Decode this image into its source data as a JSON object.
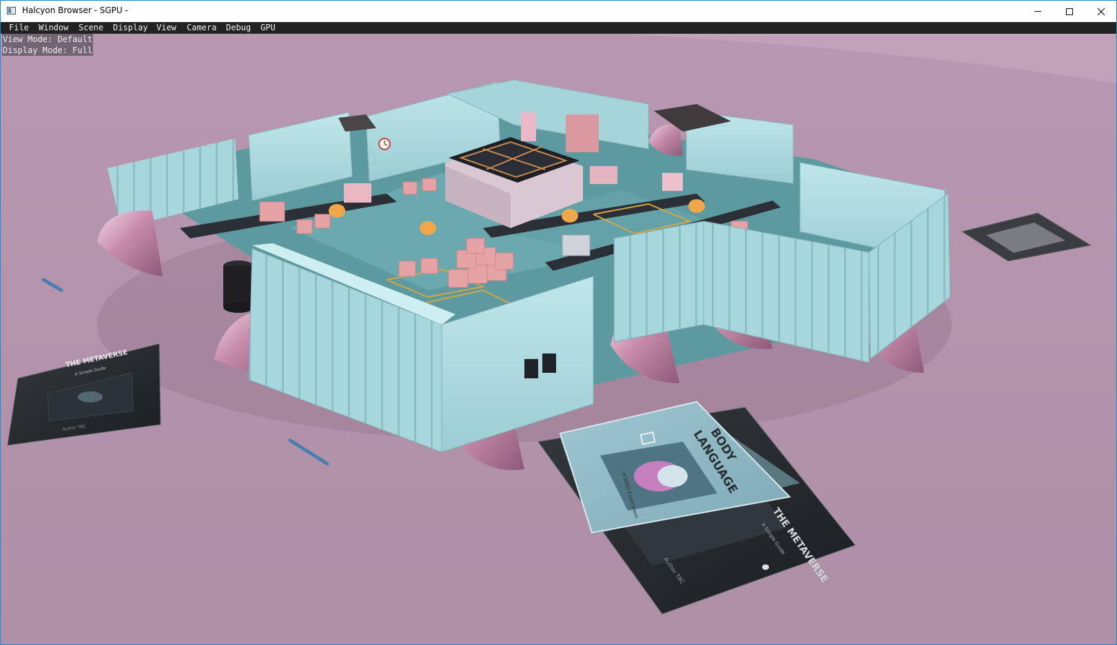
{
  "window": {
    "title": "Halcyon Browser - SGPU -",
    "icon": "app-window-icon",
    "controls": [
      "minimize-icon",
      "maximize-icon",
      "close-icon"
    ]
  },
  "menubar": {
    "items": [
      "File",
      "Window",
      "Scene",
      "Display",
      "View",
      "Camera",
      "Debug",
      "GPU"
    ]
  },
  "overlay": {
    "view_mode": "View Mode: Default",
    "display_mode": "Display Mode: Full"
  },
  "scene": {
    "book_left": {
      "title": "THE METAVERSE",
      "subtitle": "A Simple Guide",
      "author": "Author  TBC"
    },
    "book_front": {
      "title_line1": "BODY",
      "title_line2": "LANGUAGE",
      "subtitle": "A SEED Experiment"
    },
    "book_back": {
      "title": "THE METAVERSE",
      "subtitle": "A Simple Guide",
      "author": "Author  TBC"
    }
  },
  "colors": {
    "ground": "#b293ab",
    "wall": "#a9d9e0",
    "floor": "#5f9fa4",
    "box": "#e8a8a8",
    "chrome_pink": "#d890b8",
    "menubar": "#222222"
  }
}
